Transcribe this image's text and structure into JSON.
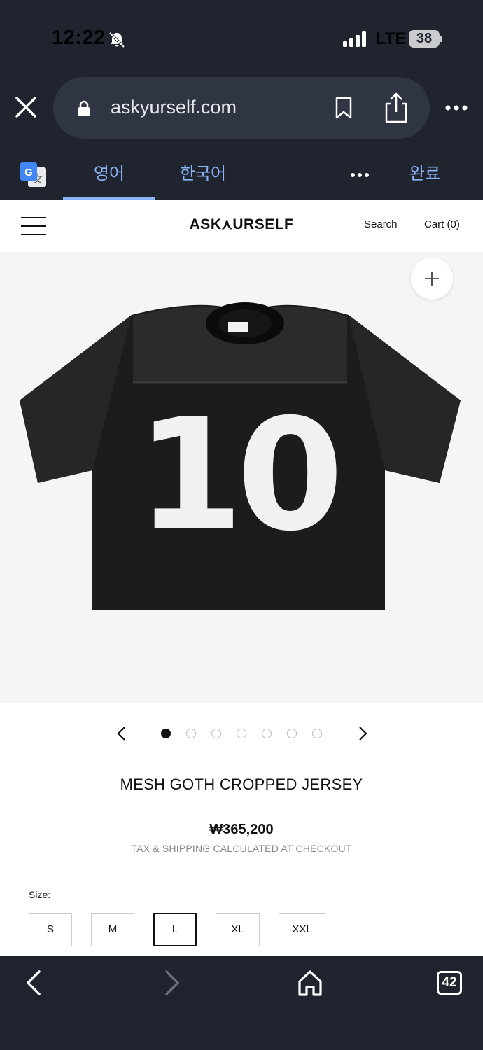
{
  "status_bar": {
    "time": "12:22",
    "network": "LTE",
    "battery": "38",
    "icons": [
      "bell-slash-icon",
      "signal-icon"
    ]
  },
  "browser": {
    "url": "askyurself.com",
    "icons": [
      "close-icon",
      "lock-icon",
      "bookmark-icon",
      "share-icon",
      "more-icon"
    ]
  },
  "translate_bar": {
    "source_language": "영어",
    "target_language": "한국어",
    "done_label": "완료",
    "icons": [
      "google-translate-icon",
      "more-icon"
    ]
  },
  "site_header": {
    "logo": "ASK⋏URSELF",
    "search_label": "Search",
    "cart_label": "Cart (0)"
  },
  "gallery": {
    "jersey_number": "10",
    "image_count": 7,
    "active_index": 0
  },
  "product": {
    "title": "MESH GOTH CROPPED JERSEY",
    "price": "₩365,200",
    "tax_note": "TAX & SHIPPING CALCULATED AT CHECKOUT",
    "size_label": "Size:",
    "sizes": [
      "S",
      "M",
      "L",
      "XL",
      "XXL"
    ],
    "selected_size": "L"
  },
  "bottom_toolbar": {
    "tab_count": "42",
    "icons": [
      "back-icon",
      "forward-icon",
      "home-icon",
      "tabs-icon"
    ]
  },
  "colors": {
    "chrome_bg": "#1f242e",
    "url_bg": "#2f3542",
    "accent_blue": "#8ab4f8",
    "gallery_bg": "#f5f5f5"
  }
}
